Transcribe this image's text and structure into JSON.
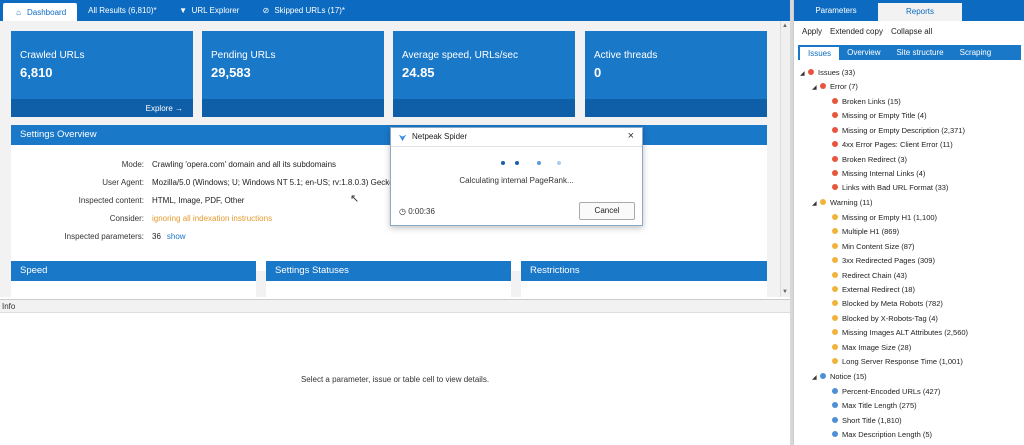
{
  "topbar": {
    "tabs": [
      {
        "label": "Dashboard",
        "icon": "home-icon",
        "active": true
      },
      {
        "label": "All Results (6,810)*",
        "icon": "",
        "active": false
      },
      {
        "label": "URL Explorer",
        "icon": "filter-icon",
        "active": false
      },
      {
        "label": "Skipped URLs (17)*",
        "icon": "skip-icon",
        "active": false
      }
    ]
  },
  "cards": [
    {
      "label": "Crawled URLs",
      "value": "6,810",
      "link": "Explore →"
    },
    {
      "label": "Pending URLs",
      "value": "29,583"
    },
    {
      "label": "Average speed, URLs/sec",
      "value": "24.85"
    },
    {
      "label": "Active threads",
      "value": "0"
    }
  ],
  "settings": {
    "title": "Settings Overview",
    "mode": {
      "key": "Mode:",
      "value": "Crawling 'opera.com' domain and all its subdomains"
    },
    "user_agent": {
      "key": "User Agent:",
      "value": "Mozilla/5.0 (Windows; U; Windows NT 5.1; en-US; rv:1.8.0.3) Gecko"
    },
    "inspected_content": {
      "key": "Inspected content:",
      "value": "HTML, Image, PDF, Other"
    },
    "consider": {
      "key": "Consider:",
      "value": "ignoring all indexation instructions"
    },
    "inspected_parameters": {
      "key": "Inspected parameters:",
      "value": "36",
      "link": "show"
    }
  },
  "bottom_panels": {
    "speed": "Speed",
    "settings_statuses": "Settings Statuses",
    "restrictions": "Restrictions"
  },
  "info": {
    "header": "Info",
    "message": "Select a parameter, issue or table cell to view details."
  },
  "right": {
    "tabs": [
      "Parameters",
      "Reports"
    ],
    "actions": [
      "Apply",
      "Extended copy",
      "Collapse all"
    ],
    "subtabs": [
      "Issues",
      "Overview",
      "Site structure",
      "Scraping"
    ]
  },
  "tree": {
    "issues": "Issues (33)",
    "error": "Error (7)",
    "errors": [
      "Broken Links (15)",
      "Missing or Empty Title (4)",
      "Missing or Empty Description (2,371)",
      "4xx Error Pages: Client Error (11)",
      "Broken Redirect (3)",
      "Missing Internal Links (4)",
      "Links with Bad URL Format (33)"
    ],
    "warning": "Warning (11)",
    "warnings": [
      "Missing or Empty H1 (1,100)",
      "Multiple H1 (869)",
      "Min Content Size (87)",
      "3xx Redirected Pages (309)",
      "Redirect Chain (43)",
      "External Redirect (18)",
      "Blocked by Meta Robots (782)",
      "Blocked by X-Robots-Tag (4)",
      "Missing Images ALT Attributes (2,560)",
      "Max Image Size (28)",
      "Long Server Response Time (1,001)"
    ],
    "notice": "Notice (15)",
    "notices": [
      "Percent-Encoded URLs (427)",
      "Max Title Length (275)",
      "Short Title (1,810)",
      "Max Description Length (5)"
    ]
  },
  "dialog": {
    "title": "Netpeak Spider",
    "message": "Calculating internal PageRank...",
    "timer": "0:00:36",
    "cancel": "Cancel"
  },
  "colors": {
    "primary": "#1a78c8",
    "dark": "#0c6bc0",
    "error": "#e8553e",
    "warning": "#f2b33d",
    "notice": "#4f8fd6",
    "consider_text": "#e59a2c"
  }
}
